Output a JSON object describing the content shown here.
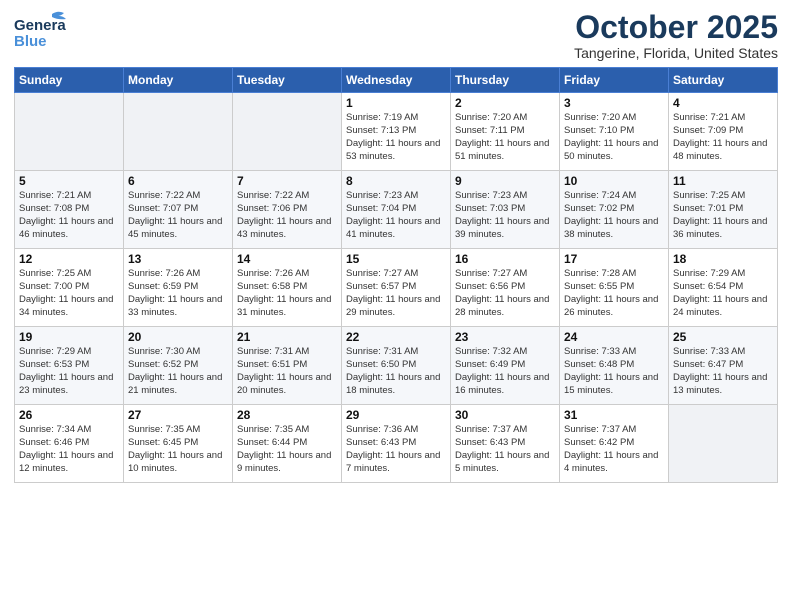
{
  "header": {
    "logo_line1": "General",
    "logo_line2": "Blue",
    "title": "October 2025",
    "subtitle": "Tangerine, Florida, United States"
  },
  "weekdays": [
    "Sunday",
    "Monday",
    "Tuesday",
    "Wednesday",
    "Thursday",
    "Friday",
    "Saturday"
  ],
  "weeks": [
    [
      {
        "day": "",
        "sunrise": "",
        "sunset": "",
        "daylight": ""
      },
      {
        "day": "",
        "sunrise": "",
        "sunset": "",
        "daylight": ""
      },
      {
        "day": "",
        "sunrise": "",
        "sunset": "",
        "daylight": ""
      },
      {
        "day": "1",
        "sunrise": "Sunrise: 7:19 AM",
        "sunset": "Sunset: 7:13 PM",
        "daylight": "Daylight: 11 hours and 53 minutes."
      },
      {
        "day": "2",
        "sunrise": "Sunrise: 7:20 AM",
        "sunset": "Sunset: 7:11 PM",
        "daylight": "Daylight: 11 hours and 51 minutes."
      },
      {
        "day": "3",
        "sunrise": "Sunrise: 7:20 AM",
        "sunset": "Sunset: 7:10 PM",
        "daylight": "Daylight: 11 hours and 50 minutes."
      },
      {
        "day": "4",
        "sunrise": "Sunrise: 7:21 AM",
        "sunset": "Sunset: 7:09 PM",
        "daylight": "Daylight: 11 hours and 48 minutes."
      }
    ],
    [
      {
        "day": "5",
        "sunrise": "Sunrise: 7:21 AM",
        "sunset": "Sunset: 7:08 PM",
        "daylight": "Daylight: 11 hours and 46 minutes."
      },
      {
        "day": "6",
        "sunrise": "Sunrise: 7:22 AM",
        "sunset": "Sunset: 7:07 PM",
        "daylight": "Daylight: 11 hours and 45 minutes."
      },
      {
        "day": "7",
        "sunrise": "Sunrise: 7:22 AM",
        "sunset": "Sunset: 7:06 PM",
        "daylight": "Daylight: 11 hours and 43 minutes."
      },
      {
        "day": "8",
        "sunrise": "Sunrise: 7:23 AM",
        "sunset": "Sunset: 7:04 PM",
        "daylight": "Daylight: 11 hours and 41 minutes."
      },
      {
        "day": "9",
        "sunrise": "Sunrise: 7:23 AM",
        "sunset": "Sunset: 7:03 PM",
        "daylight": "Daylight: 11 hours and 39 minutes."
      },
      {
        "day": "10",
        "sunrise": "Sunrise: 7:24 AM",
        "sunset": "Sunset: 7:02 PM",
        "daylight": "Daylight: 11 hours and 38 minutes."
      },
      {
        "day": "11",
        "sunrise": "Sunrise: 7:25 AM",
        "sunset": "Sunset: 7:01 PM",
        "daylight": "Daylight: 11 hours and 36 minutes."
      }
    ],
    [
      {
        "day": "12",
        "sunrise": "Sunrise: 7:25 AM",
        "sunset": "Sunset: 7:00 PM",
        "daylight": "Daylight: 11 hours and 34 minutes."
      },
      {
        "day": "13",
        "sunrise": "Sunrise: 7:26 AM",
        "sunset": "Sunset: 6:59 PM",
        "daylight": "Daylight: 11 hours and 33 minutes."
      },
      {
        "day": "14",
        "sunrise": "Sunrise: 7:26 AM",
        "sunset": "Sunset: 6:58 PM",
        "daylight": "Daylight: 11 hours and 31 minutes."
      },
      {
        "day": "15",
        "sunrise": "Sunrise: 7:27 AM",
        "sunset": "Sunset: 6:57 PM",
        "daylight": "Daylight: 11 hours and 29 minutes."
      },
      {
        "day": "16",
        "sunrise": "Sunrise: 7:27 AM",
        "sunset": "Sunset: 6:56 PM",
        "daylight": "Daylight: 11 hours and 28 minutes."
      },
      {
        "day": "17",
        "sunrise": "Sunrise: 7:28 AM",
        "sunset": "Sunset: 6:55 PM",
        "daylight": "Daylight: 11 hours and 26 minutes."
      },
      {
        "day": "18",
        "sunrise": "Sunrise: 7:29 AM",
        "sunset": "Sunset: 6:54 PM",
        "daylight": "Daylight: 11 hours and 24 minutes."
      }
    ],
    [
      {
        "day": "19",
        "sunrise": "Sunrise: 7:29 AM",
        "sunset": "Sunset: 6:53 PM",
        "daylight": "Daylight: 11 hours and 23 minutes."
      },
      {
        "day": "20",
        "sunrise": "Sunrise: 7:30 AM",
        "sunset": "Sunset: 6:52 PM",
        "daylight": "Daylight: 11 hours and 21 minutes."
      },
      {
        "day": "21",
        "sunrise": "Sunrise: 7:31 AM",
        "sunset": "Sunset: 6:51 PM",
        "daylight": "Daylight: 11 hours and 20 minutes."
      },
      {
        "day": "22",
        "sunrise": "Sunrise: 7:31 AM",
        "sunset": "Sunset: 6:50 PM",
        "daylight": "Daylight: 11 hours and 18 minutes."
      },
      {
        "day": "23",
        "sunrise": "Sunrise: 7:32 AM",
        "sunset": "Sunset: 6:49 PM",
        "daylight": "Daylight: 11 hours and 16 minutes."
      },
      {
        "day": "24",
        "sunrise": "Sunrise: 7:33 AM",
        "sunset": "Sunset: 6:48 PM",
        "daylight": "Daylight: 11 hours and 15 minutes."
      },
      {
        "day": "25",
        "sunrise": "Sunrise: 7:33 AM",
        "sunset": "Sunset: 6:47 PM",
        "daylight": "Daylight: 11 hours and 13 minutes."
      }
    ],
    [
      {
        "day": "26",
        "sunrise": "Sunrise: 7:34 AM",
        "sunset": "Sunset: 6:46 PM",
        "daylight": "Daylight: 11 hours and 12 minutes."
      },
      {
        "day": "27",
        "sunrise": "Sunrise: 7:35 AM",
        "sunset": "Sunset: 6:45 PM",
        "daylight": "Daylight: 11 hours and 10 minutes."
      },
      {
        "day": "28",
        "sunrise": "Sunrise: 7:35 AM",
        "sunset": "Sunset: 6:44 PM",
        "daylight": "Daylight: 11 hours and 9 minutes."
      },
      {
        "day": "29",
        "sunrise": "Sunrise: 7:36 AM",
        "sunset": "Sunset: 6:43 PM",
        "daylight": "Daylight: 11 hours and 7 minutes."
      },
      {
        "day": "30",
        "sunrise": "Sunrise: 7:37 AM",
        "sunset": "Sunset: 6:43 PM",
        "daylight": "Daylight: 11 hours and 5 minutes."
      },
      {
        "day": "31",
        "sunrise": "Sunrise: 7:37 AM",
        "sunset": "Sunset: 6:42 PM",
        "daylight": "Daylight: 11 hours and 4 minutes."
      },
      {
        "day": "",
        "sunrise": "",
        "sunset": "",
        "daylight": ""
      }
    ]
  ]
}
